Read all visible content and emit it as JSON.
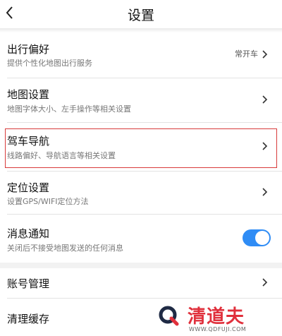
{
  "header": {
    "title": "设置",
    "back_icon": "chevron-left-icon"
  },
  "rows": [
    {
      "label": "出行偏好",
      "sub": "提供个性化地图出行服务",
      "value": "常开车"
    },
    {
      "label": "地图设置",
      "sub": "地图字体大小、左手操作等相关设置"
    },
    {
      "label": "驾车导航",
      "sub": "线路偏好、导航语言等相关设置"
    },
    {
      "label": "定位设置",
      "sub": "设置GPS/WIFI定位方法"
    },
    {
      "label": "消息通知",
      "sub": "关闭后不接受地图发送的任何消息",
      "toggle_on": true
    },
    {
      "label": "账号管理"
    },
    {
      "label": "清理缓存"
    }
  ],
  "colors": {
    "accent": "#2f8cf5",
    "highlight": "#d83a3a",
    "brand": "#e0303c"
  },
  "watermark": {
    "name": "清道夫",
    "url": "WWW.QDFUJI.COM"
  }
}
